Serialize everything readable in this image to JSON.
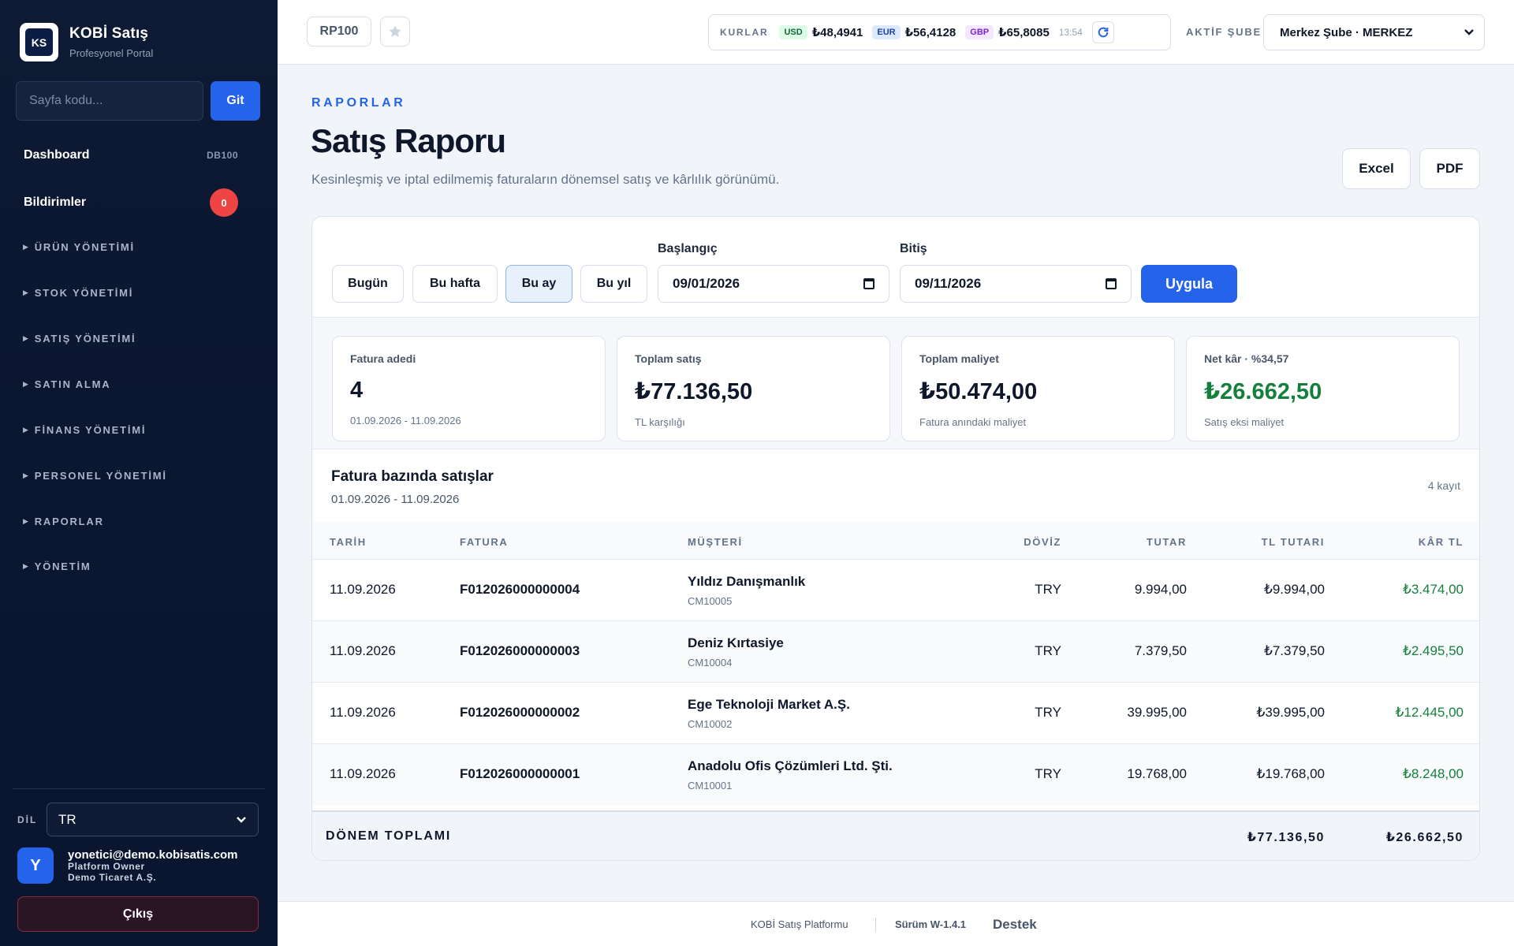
{
  "sidebar": {
    "brand_title": "KOBİ Satış",
    "brand_sub": "Profesyonel Portal",
    "logo_text": "KS",
    "page_code_placeholder": "Sayfa kodu...",
    "go_label": "Git",
    "dashboard_label": "Dashboard",
    "dashboard_code": "DB100",
    "notifications_label": "Bildirimler",
    "notifications_count": "0",
    "groups": [
      "ÜRÜN YÖNETİMİ",
      "STOK YÖNETİMİ",
      "SATIŞ YÖNETİMİ",
      "SATIN ALMA",
      "FİNANS YÖNETİMİ",
      "PERSONEL YÖNETİMİ",
      "RAPORLAR",
      "YÖNETİM"
    ],
    "lang_label": "DİL",
    "lang_value": "TR",
    "user_initial": "Y",
    "user_email": "yonetici@demo.kobisatis.com",
    "user_role": "Platform Owner",
    "user_company": "Demo Ticaret A.Ş.",
    "logout_label": "Çıkış"
  },
  "topbar": {
    "page_code": "RP100",
    "rates_label": "KURLAR",
    "usd_tag": "USD",
    "usd_value": "₺48,4941",
    "eur_tag": "EUR",
    "eur_value": "₺56,4128",
    "gbp_tag": "GBP",
    "gbp_value": "₺65,8085",
    "rates_time": "13:54",
    "branch_label": "AKTİF ŞUBE",
    "branch_value": "Merkez Şube · MERKEZ"
  },
  "header": {
    "eyebrow": "RAPORLAR",
    "title": "Satış Raporu",
    "description": "Kesinleşmiş ve iptal edilmemiş faturaların dönemsel satış ve kârlılık görünümü.",
    "excel_label": "Excel",
    "pdf_label": "PDF"
  },
  "filters": {
    "today": "Bugün",
    "week": "Bu hafta",
    "month": "Bu ay",
    "year": "Bu yıl",
    "start_label": "Başlangıç",
    "start_value": "09/01/2026",
    "end_label": "Bitiş",
    "end_value": "09/11/2026",
    "apply": "Uygula"
  },
  "kpis": [
    {
      "label": "Fatura adedi",
      "value": "4",
      "sub": "01.09.2026 - 11.09.2026"
    },
    {
      "label": "Toplam satış",
      "value": "₺77.136,50",
      "sub": "TL karşılığı"
    },
    {
      "label": "Toplam maliyet",
      "value": "₺50.474,00",
      "sub": "Fatura anındaki maliyet"
    },
    {
      "label": "Net kâr · %34,57",
      "value": "₺26.662,50",
      "sub": "Satış eksi maliyet"
    }
  ],
  "table": {
    "title": "Fatura bazında satışlar",
    "range": "01.09.2026 - 11.09.2026",
    "count": "4 kayıt",
    "columns": {
      "date": "TARİH",
      "invoice": "FATURA",
      "customer": "MÜŞTERİ",
      "currency": "DÖVİZ",
      "amount": "TUTAR",
      "tl_amount": "TL TUTARI",
      "profit": "KÂR TL"
    },
    "rows": [
      {
        "date": "11.09.2026",
        "invoice": "F012026000000004",
        "customer": "Yıldız Danışmanlık",
        "customer_code": "CM10005",
        "currency": "TRY",
        "amount": "9.994,00",
        "tl_amount": "₺9.994,00",
        "profit": "₺3.474,00"
      },
      {
        "date": "11.09.2026",
        "invoice": "F012026000000003",
        "customer": "Deniz Kırtasiye",
        "customer_code": "CM10004",
        "currency": "TRY",
        "amount": "7.379,50",
        "tl_amount": "₺7.379,50",
        "profit": "₺2.495,50"
      },
      {
        "date": "11.09.2026",
        "invoice": "F012026000000002",
        "customer": "Ege Teknoloji Market A.Ş.",
        "customer_code": "CM10002",
        "currency": "TRY",
        "amount": "39.995,00",
        "tl_amount": "₺39.995,00",
        "profit": "₺12.445,00"
      },
      {
        "date": "11.09.2026",
        "invoice": "F012026000000001",
        "customer": "Anadolu Ofis Çözümleri Ltd. Şti.",
        "customer_code": "CM10001",
        "currency": "TRY",
        "amount": "19.768,00",
        "tl_amount": "₺19.768,00",
        "profit": "₺8.248,00"
      }
    ],
    "total_label": "DÖNEM TOPLAMI",
    "total_tl": "₺77.136,50",
    "total_profit": "₺26.662,50"
  },
  "footer": {
    "platform": "KOBİ Satış Platformu",
    "version": "Sürüm W-1.4.1",
    "support": "Destek"
  },
  "colors": {
    "accent": "#2563eb",
    "profit_green": "#15803d",
    "sidebar_bg": "#0e1a33",
    "danger": "#ef4444"
  }
}
